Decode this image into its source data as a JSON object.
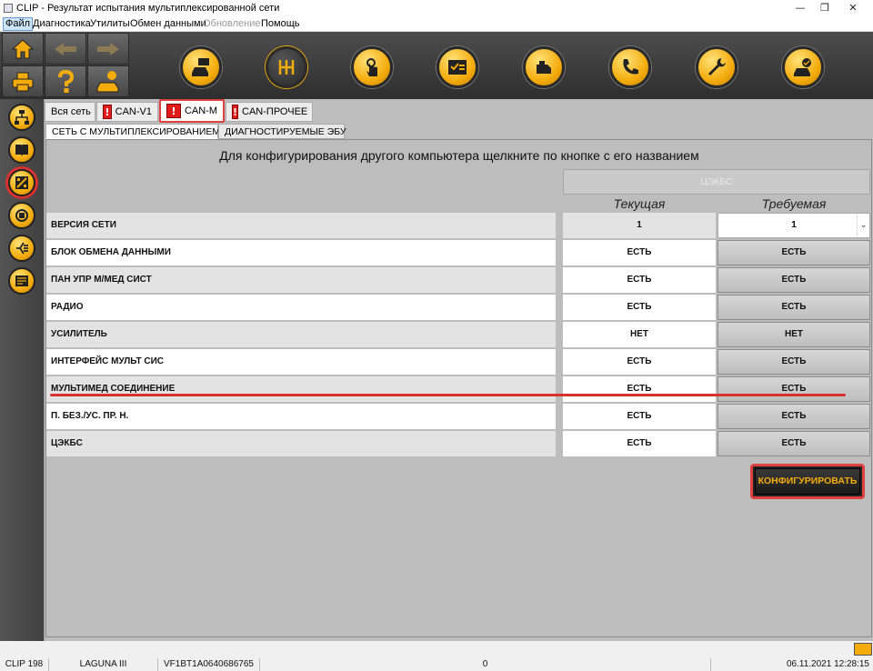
{
  "window": {
    "title": "CLIP - Результат испытания мультиплексированной сети",
    "minimize": "—",
    "restore": "❐",
    "close": "✕"
  },
  "menu": [
    "Файл",
    "Диагностика",
    "Утилиты",
    "Обмен данными",
    "Обновление",
    "Помощь"
  ],
  "tabs": [
    "Вся сеть",
    "CAN-V1",
    "CAN-M",
    "CAN-ПРОЧЕЕ"
  ],
  "tab_alert_mark": "!",
  "subtabs": [
    "СЕТЬ С МУЛЬТИПЛЕКСИРОВАНИЕМ",
    "ДИАГНОСТИРУЕМЫЕ ЭБУ"
  ],
  "instruction": "Для конфигурирования другого компьютера щелкните по кнопке с его названием",
  "ecu_button": "ЦЭКБС",
  "columns": {
    "current": "Текущая",
    "required": "Требуемая"
  },
  "rows": [
    {
      "label": "ВЕРСИЯ СЕТИ",
      "current": "1",
      "required": "1"
    },
    {
      "label": "БЛОК ОБМЕНА ДАННЫМИ",
      "current": "ЕСТЬ",
      "required": "ЕСТЬ"
    },
    {
      "label": "ПАН УПР М/МЕД СИСТ",
      "current": "ЕСТЬ",
      "required": "ЕСТЬ"
    },
    {
      "label": "РАДИО",
      "current": "ЕСТЬ",
      "required": "ЕСТЬ"
    },
    {
      "label": "УСИЛИТЕЛЬ",
      "current": "НЕТ",
      "required": "НЕТ"
    },
    {
      "label": "ИНТЕРФЕЙС МУЛЬТ СИС",
      "current": "ЕСТЬ",
      "required": "ЕСТЬ"
    },
    {
      "label": "МУЛЬТИМЕД СОЕДИНЕНИЕ",
      "current": "ЕСТЬ",
      "required": "ЕСТЬ"
    },
    {
      "label": "П. БЕЗ./УС. ПР. Н.",
      "current": "ЕСТЬ",
      "required": "ЕСТЬ"
    },
    {
      "label": "ЦЭКБС",
      "current": "ЕСТЬ",
      "required": "ЕСТЬ"
    }
  ],
  "select_arrow": "⌄",
  "configure_button": "КОНФИГУРИРОВАТЬ",
  "statusbar": [
    "CLIP 198",
    "LAGUNA III",
    "VF1BT1A0640686765",
    "0",
    "06.11.2021 12:28:15"
  ],
  "accent_color": "#f4ac0d",
  "highlight_color": "#d93030",
  "toolbar_icons": [
    "vehicle-diagnostic-icon",
    "gearbox-icon",
    "touch-icon",
    "checklist-icon",
    "engine-icon",
    "phone-support-icon",
    "wrench-icon",
    "car-check-icon"
  ],
  "sidebar_icons": [
    "network-icon",
    "book-icon",
    "multiplex-network-icon",
    "recycle-network-icon",
    "signal-icon",
    "document-icon"
  ]
}
